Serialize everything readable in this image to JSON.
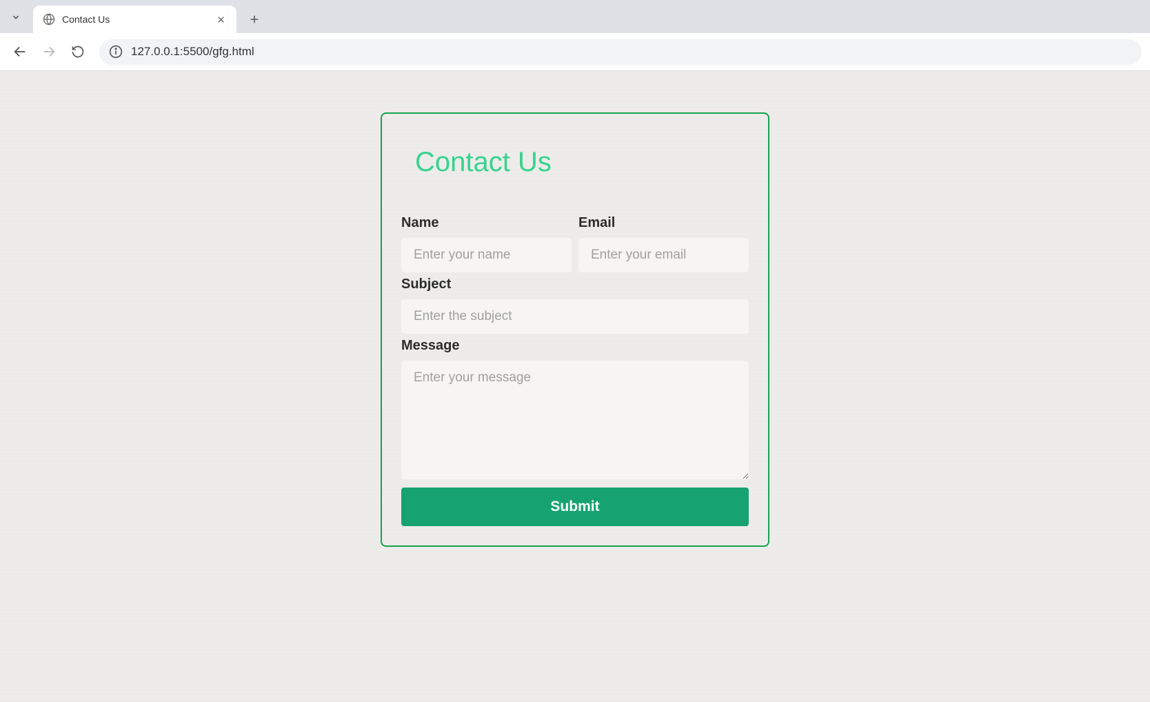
{
  "browser": {
    "tab_title": "Contact Us",
    "url": "127.0.0.1:5500/gfg.html"
  },
  "form": {
    "heading": "Contact Us",
    "name": {
      "label": "Name",
      "placeholder": "Enter your name",
      "value": ""
    },
    "email": {
      "label": "Email",
      "placeholder": "Enter your email",
      "value": ""
    },
    "subject": {
      "label": "Subject",
      "placeholder": "Enter the subject",
      "value": ""
    },
    "message": {
      "label": "Message",
      "placeholder": "Enter your message",
      "value": ""
    },
    "submit_label": "Submit"
  },
  "colors": {
    "card_border": "#16a34a",
    "heading": "#36d38e",
    "submit_bg": "#16a371"
  }
}
